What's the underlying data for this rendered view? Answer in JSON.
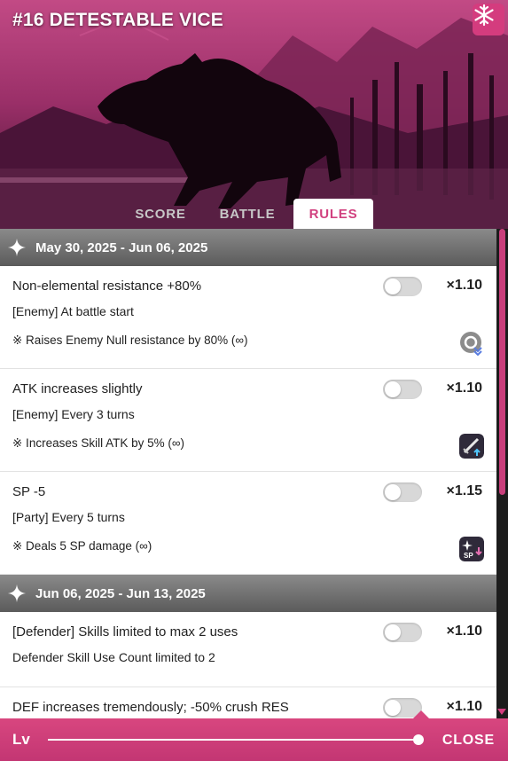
{
  "header": {
    "title": "#16 DETESTABLE VICE",
    "settings_icon": "snowflake-icon"
  },
  "tabs": [
    {
      "label": "SCORE",
      "active": false
    },
    {
      "label": "BATTLE",
      "active": false
    },
    {
      "label": "RULES",
      "active": true
    }
  ],
  "periods": [
    {
      "label": "May 30, 2025 - Jun 06, 2025",
      "rules": [
        {
          "name": "Non-elemental resistance +80%",
          "mult": "×1.10",
          "cond": "[Enemy] At battle start",
          "effect": "※ Raises Enemy Null resistance by 80% (∞)",
          "icon": "null-resist-icon",
          "enabled": false
        },
        {
          "name": "ATK increases slightly",
          "mult": "×1.10",
          "cond": "[Enemy] Every 3 turns",
          "effect": "※ Increases Skill ATK by 5% (∞)",
          "icon": "sword-up-icon",
          "enabled": false
        },
        {
          "name": "SP -5",
          "mult": "×1.15",
          "cond": "[Party] Every 5 turns",
          "effect": "※ Deals 5 SP damage (∞)",
          "icon": "sp-down-icon",
          "enabled": false
        }
      ]
    },
    {
      "label": "Jun 06, 2025 - Jun 13, 2025",
      "rules": [
        {
          "name": "[Defender] Skills limited to max 2 uses",
          "mult": "×1.10",
          "cond": "Defender Skill Use Count limited to 2",
          "enabled": false
        },
        {
          "name": "DEF increases tremendously; -50% crush RES",
          "mult": "×1.10",
          "enabled": false
        }
      ]
    }
  ],
  "footer": {
    "lv_label": "Lv",
    "close_label": "CLOSE",
    "level_fraction": 1.0
  },
  "colors": {
    "accent": "#d43c7e",
    "period_bg": "#6e6e6e"
  }
}
